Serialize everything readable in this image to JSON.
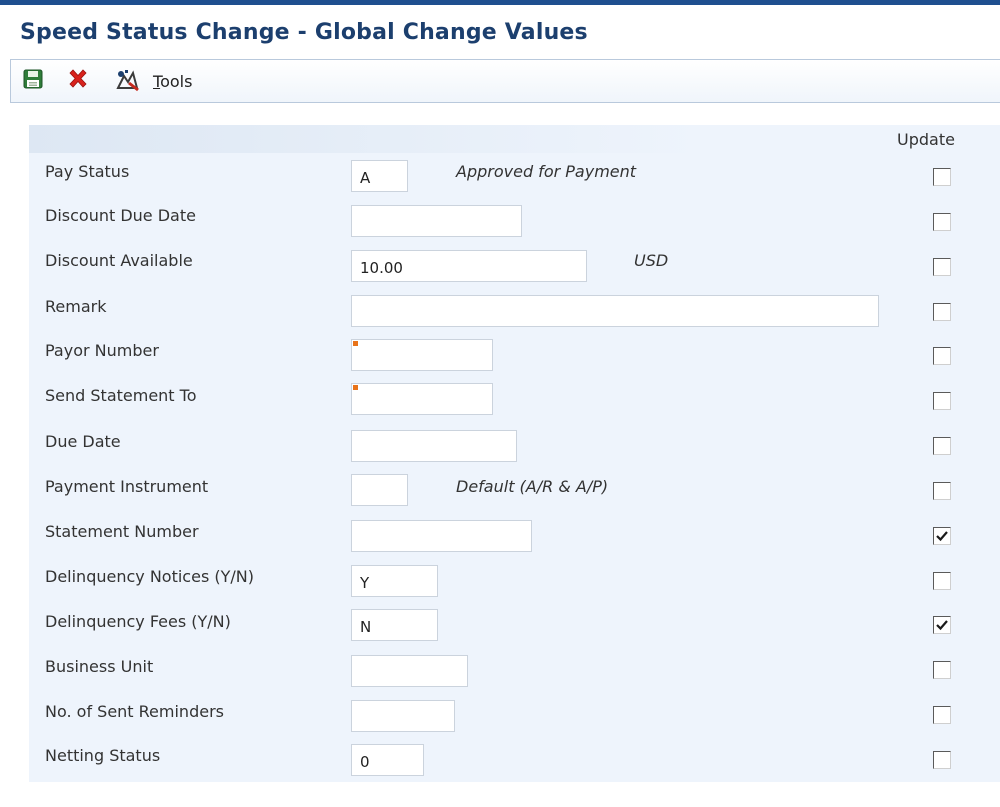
{
  "window": {
    "title": "Speed Status Change - Global Change Values"
  },
  "toolbar": {
    "save_icon": "save-icon",
    "cancel_icon": "cancel-icon",
    "tools_icon": "tools-icon",
    "tools_label_first": "T",
    "tools_label_rest": "ools"
  },
  "form": {
    "update_header": "Update",
    "rows": [
      {
        "label": "Pay Status",
        "value": "A",
        "description": "Approved for Payment",
        "update": false
      },
      {
        "label": "Discount Due Date",
        "value": "",
        "update": false
      },
      {
        "label": "Discount Available",
        "value": "10.00",
        "description": "USD",
        "update": false
      },
      {
        "label": "Remark",
        "value": "",
        "update": false
      },
      {
        "label": "Payor Number",
        "value": "",
        "required": true,
        "update": false
      },
      {
        "label": "Send Statement To",
        "value": "",
        "required": true,
        "update": false
      },
      {
        "label": "Due Date",
        "value": "",
        "update": false
      },
      {
        "label": "Payment Instrument",
        "value": "",
        "description": "Default (A/R & A/P)",
        "update": false
      },
      {
        "label": "Statement Number",
        "value": "",
        "update": true
      },
      {
        "label": "Delinquency Notices (Y/N)",
        "value": "Y",
        "update": false
      },
      {
        "label": "Delinquency Fees (Y/N)",
        "value": "N",
        "update": true
      },
      {
        "label": "Business Unit",
        "value": "",
        "update": false
      },
      {
        "label": "No. of Sent Reminders",
        "value": "",
        "update": false
      },
      {
        "label": "Netting Status",
        "value": "0",
        "update": false
      }
    ]
  }
}
